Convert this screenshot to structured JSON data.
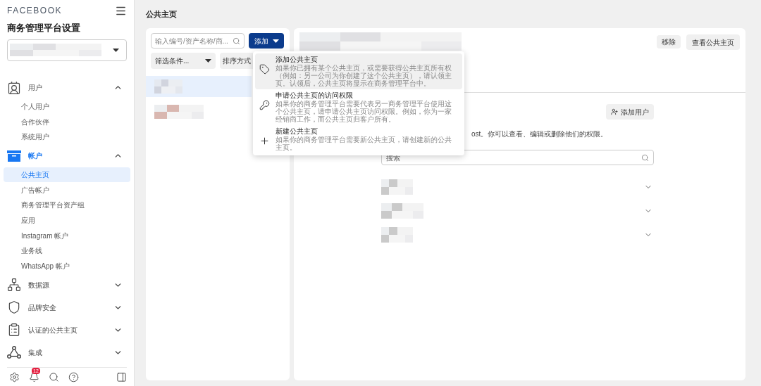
{
  "sidebar": {
    "brand": "FACEBOOK",
    "title": "商务管理平台设置",
    "sections": [
      {
        "kind": "users",
        "label": "用户",
        "active": false,
        "expanded": true,
        "children": [
          {
            "label": "个人用户",
            "selected": false
          },
          {
            "label": "合作伙伴",
            "selected": false
          },
          {
            "label": "系统用户",
            "selected": false
          }
        ]
      },
      {
        "kind": "accounts",
        "label": "帐户",
        "active": true,
        "expanded": true,
        "children": [
          {
            "label": "公共主页",
            "selected": true
          },
          {
            "label": "广告帐户",
            "selected": false
          },
          {
            "label": "商务管理平台资产组",
            "selected": false
          },
          {
            "label": "应用",
            "selected": false
          },
          {
            "label": "Instagram 帐户",
            "selected": false
          },
          {
            "label": "业务线",
            "selected": false
          },
          {
            "label": "WhatsApp 帐户",
            "selected": false
          }
        ]
      },
      {
        "kind": "data",
        "label": "数据源",
        "active": false,
        "expanded": false
      },
      {
        "kind": "safety",
        "label": "品牌安全",
        "active": false,
        "expanded": false
      },
      {
        "kind": "verified",
        "label": "认证的公共主页",
        "active": false,
        "expanded": false
      },
      {
        "kind": "integrations",
        "label": "集成",
        "active": false,
        "expanded": false
      }
    ],
    "notification_count": "12"
  },
  "page_title": "公共主页",
  "list_panel": {
    "search": {
      "placeholder": "输入编号/资产名称/商..."
    },
    "add_button": "添加",
    "filter": "筛选条件...",
    "sort": "排序方式",
    "items": [
      {
        "selected": true
      },
      {
        "selected": false
      }
    ]
  },
  "add_menu": [
    {
      "kind": "tag",
      "title": "添加公共主页",
      "description": "如果你已拥有某个公共主页，或需要获得公共主页所有权（例如：另一公司为你创建了这个公共主页），请认领主页。认领后，公共主页将显示在商务管理平台中。",
      "selected": true
    },
    {
      "kind": "key",
      "title": "申请公共主页的访问权限",
      "description": "如果你的商务管理平台需要代表另一商务管理平台使用这个公共主页，请申请公共主页访问权限。例如，你为一家经销商工作，而公共主页归客户所有。",
      "selected": false
    },
    {
      "kind": "plus",
      "title": "新建公共主页",
      "description": "如果你的商务管理平台需要新公共主页，请创建新的公共主页。",
      "selected": false
    }
  ],
  "detail": {
    "remove_button": "移除",
    "view_button": "查看公共主页",
    "add_user_button": "添加用户",
    "permissions_note": "ost。你可以查看、编辑或删除他们的权限。",
    "people_search": {
      "placeholder": "搜索"
    },
    "people": [
      {
        "expanded": false
      },
      {
        "expanded": false
      },
      {
        "expanded": false
      }
    ]
  }
}
